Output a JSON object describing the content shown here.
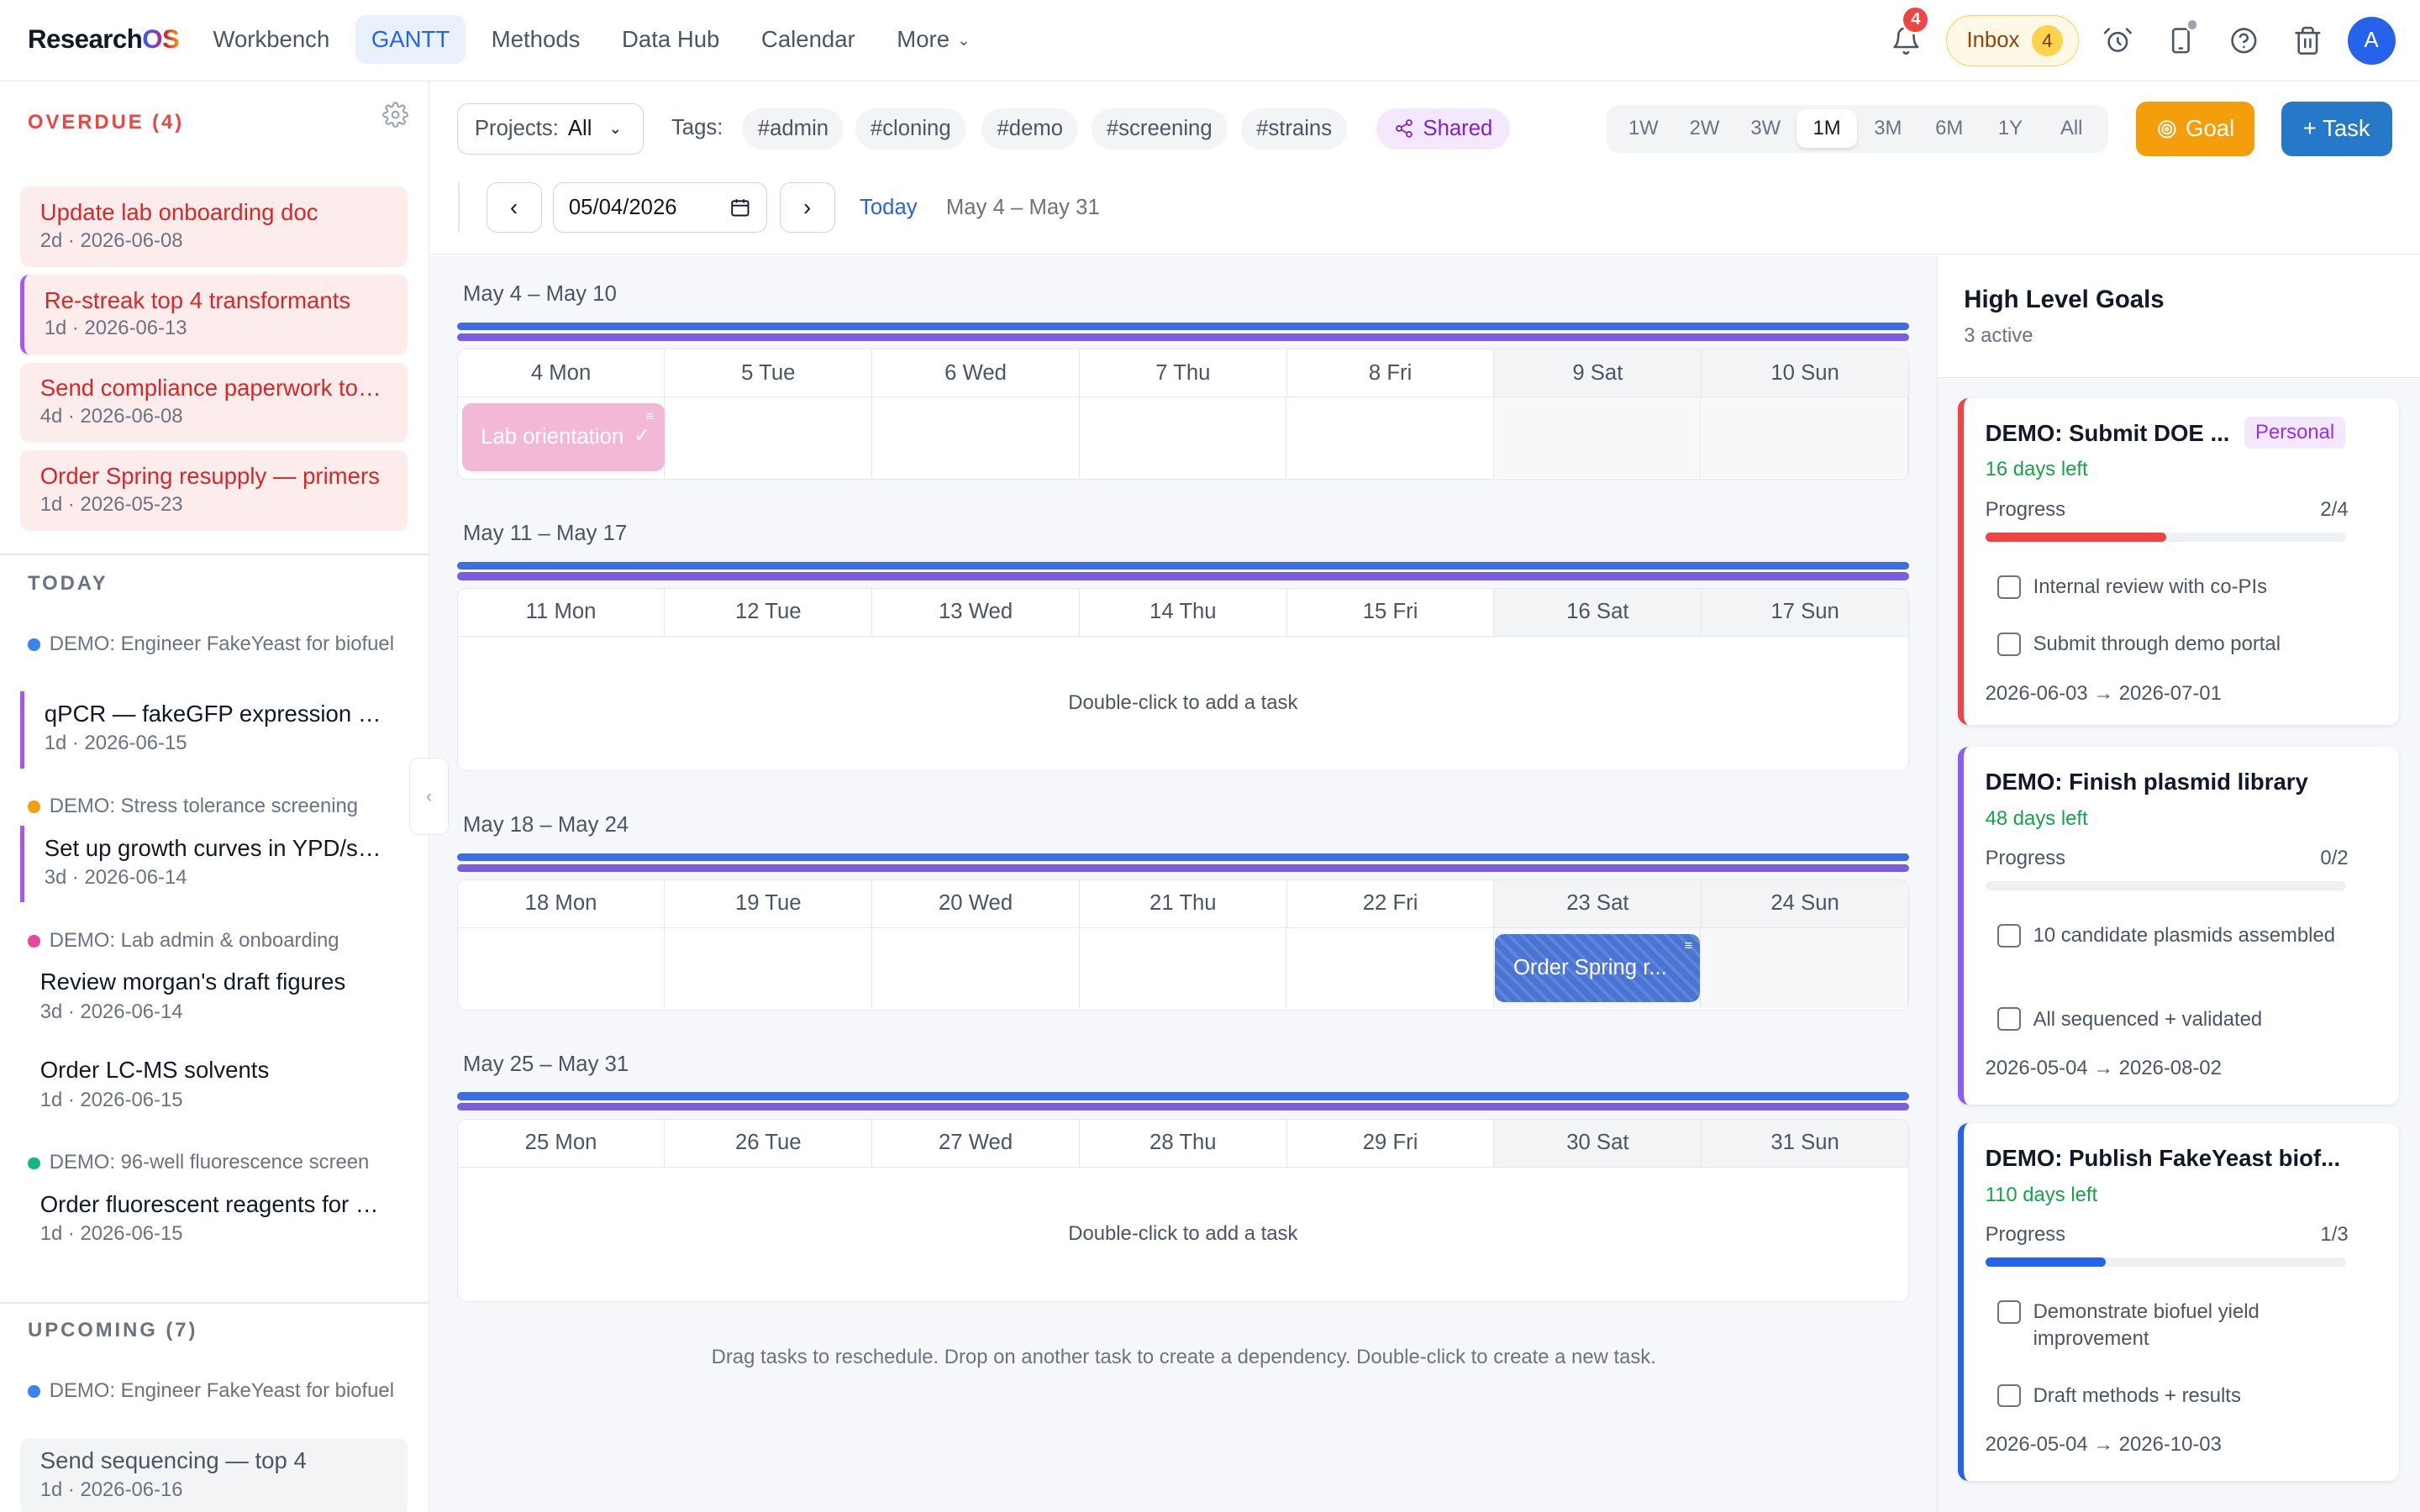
{
  "app": {
    "logo_a": "Research",
    "logo_b": "OS"
  },
  "nav": {
    "items": [
      "Workbench",
      "GANTT",
      "Methods",
      "Data Hub",
      "Calendar",
      "More"
    ],
    "notif_count": "4",
    "inbox_label": "Inbox",
    "inbox_count": "4",
    "avatar": "A"
  },
  "sidebar": {
    "overdue_title": "OVERDUE (4)",
    "overdue": [
      {
        "title": "Update lab onboarding doc",
        "meta": "2d · 2026-06-08"
      },
      {
        "title": "Re-streak top 4 transformants",
        "meta": "1d · 2026-06-13"
      },
      {
        "title": "Send compliance paperwork to IRB",
        "meta": "4d · 2026-06-08"
      },
      {
        "title": "Order Spring resupply — primers",
        "meta": "1d · 2026-05-23"
      }
    ],
    "today_title": "TODAY",
    "today": [
      {
        "project": "DEMO: Engineer FakeYeast for biofuel",
        "color": "#3b82f6",
        "task": "qPCR — fakeGFP expression validation",
        "meta": "1d · 2026-06-15"
      },
      {
        "project": "DEMO: Stress tolerance screening",
        "color": "#f59e0b",
        "task": "Set up growth curves in YPD/stress media",
        "meta": "3d · 2026-06-14"
      },
      {
        "project": "DEMO: Lab admin & onboarding",
        "color": "#ec4899",
        "task": "Review morgan's draft figures",
        "meta": "3d · 2026-06-14"
      },
      {
        "task": "Order LC-MS solvents",
        "meta": "1d · 2026-06-15"
      },
      {
        "project": "DEMO: 96-well fluorescence screen",
        "color": "#10b981",
        "task": "Order fluorescent reagents for screen",
        "meta": "1d · 2026-06-15"
      }
    ],
    "upcoming_title": "UPCOMING (7)",
    "upcoming": [
      {
        "project": "DEMO: Engineer FakeYeast for biofuel",
        "color": "#3b82f6",
        "task": "Send sequencing — top 4",
        "meta": "1d · 2026-06-16"
      }
    ]
  },
  "toolbar": {
    "projects_label": "Projects:",
    "projects_value": "All",
    "tags_label": "Tags:",
    "tags": [
      "#admin",
      "#cloning",
      "#demo",
      "#screening",
      "#strains"
    ],
    "shared_label": "Shared",
    "ranges": [
      "1W",
      "2W",
      "3W",
      "1M",
      "3M",
      "6M",
      "1Y",
      "All"
    ],
    "active_range": "1M",
    "goal_label": "Goal",
    "task_label": "+ Task",
    "date_value": "05/04/2026",
    "today_label": "Today",
    "range_text": "May 4 – May 31"
  },
  "weeks": [
    {
      "label": "May 4 – May 10",
      "days": [
        "4 Mon",
        "5 Tue",
        "6 Wed",
        "7 Thu",
        "8 Fri",
        "9 Sat",
        "10 Sun"
      ],
      "empty_text": "",
      "task": "Lab orientation"
    },
    {
      "label": "May 11 – May 17",
      "days": [
        "11 Mon",
        "12 Tue",
        "13 Wed",
        "14 Thu",
        "15 Fri",
        "16 Sat",
        "17 Sun"
      ],
      "empty_text": "Double-click to add a task"
    },
    {
      "label": "May 18 – May 24",
      "days": [
        "18 Mon",
        "19 Tue",
        "20 Wed",
        "21 Thu",
        "22 Fri",
        "23 Sat",
        "24 Sun"
      ],
      "empty_text": "",
      "task": "Order Spring r..."
    },
    {
      "label": "May 25 – May 31",
      "days": [
        "25 Mon",
        "26 Tue",
        "27 Wed",
        "28 Thu",
        "29 Fri",
        "30 Sat",
        "31 Sun"
      ],
      "empty_text": "Double-click to add a task"
    }
  ],
  "hint": "Drag tasks to reschedule. Drop on another task to create a dependency. Double-click to create a new task.",
  "goals": {
    "title": "High Level Goals",
    "subtitle": "3 active",
    "cards": [
      {
        "title": "DEMO: Submit DOE ...",
        "tag": "Personal",
        "days": "16 days left",
        "progress_label": "Progress",
        "progress_text": "2/4",
        "progress": 0.5,
        "bar_color": "#ef4444",
        "border": "#ef4444",
        "items": [
          "Internal review with co-PIs",
          "Submit through demo portal"
        ],
        "dates": "2026-06-03 → 2026-07-01"
      },
      {
        "title": "DEMO: Finish plasmid library",
        "days": "48 days left",
        "progress_label": "Progress",
        "progress_text": "0/2",
        "progress": 0,
        "bar_color": "#8b5cf6",
        "border": "#8b5cf6",
        "items": [
          "10 candidate plasmids assembled",
          "All sequenced + validated"
        ],
        "dates": "2026-05-04 → 2026-08-02"
      },
      {
        "title": "DEMO: Publish FakeYeast biof...",
        "days": "110 days left",
        "progress_label": "Progress",
        "progress_text": "1/3",
        "progress": 0.333,
        "bar_color": "#2563eb",
        "border": "#2563eb",
        "items": [
          "Demonstrate biofuel yield improvement",
          "Draft methods + results"
        ],
        "dates": "2026-05-04 → 2026-10-03"
      }
    ]
  },
  "colors": {
    "accent": "#2563eb",
    "overdue": "#dc2626",
    "goal_button": "#f59e0b",
    "task_button": "#2678c9"
  }
}
